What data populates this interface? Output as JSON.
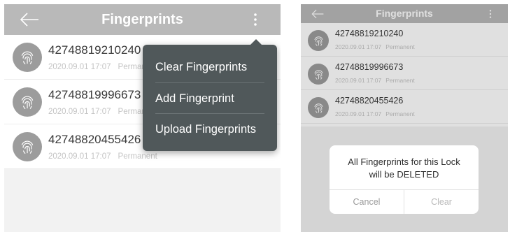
{
  "left_screen": {
    "header": {
      "title": "Fingerprints"
    },
    "fingerprints": [
      {
        "id": "42748819210240",
        "date": "2020.09.01 17:07",
        "validity": "Permanent"
      },
      {
        "id": "42748819996673",
        "date": "2020.09.01 17:07",
        "validity": "Permanent"
      },
      {
        "id": "42748820455426",
        "date": "2020.09.01 17:07",
        "validity": "Permanent"
      }
    ],
    "menu": [
      {
        "label": "Clear Fingerprints"
      },
      {
        "label": "Add Fingerprint"
      },
      {
        "label": "Upload Fingerprints"
      }
    ]
  },
  "right_screen": {
    "header": {
      "title": "Fingerprints"
    },
    "fingerprints": [
      {
        "id": "42748819210240",
        "date": "2020.09.01 17:07",
        "validity": "Permanent"
      },
      {
        "id": "42748819996673",
        "date": "2020.09.01 17:07",
        "validity": "Permanent"
      },
      {
        "id": "42748820455426",
        "date": "2020.09.01 17:07",
        "validity": "Permanent"
      }
    ],
    "dialog": {
      "message_line1": "All Fingerprints for this Lock",
      "message_line2": "will be DELETED",
      "cancel_label": "Cancel",
      "confirm_label": "Clear"
    }
  },
  "icons": {
    "back": "arrow-left-icon",
    "more": "more-vertical-icon",
    "fingerprint": "fingerprint-icon"
  },
  "colors": {
    "header_bg": "#b9b9b9",
    "menu_bg": "#50585a",
    "avatar_bg": "#9c9c9c"
  }
}
